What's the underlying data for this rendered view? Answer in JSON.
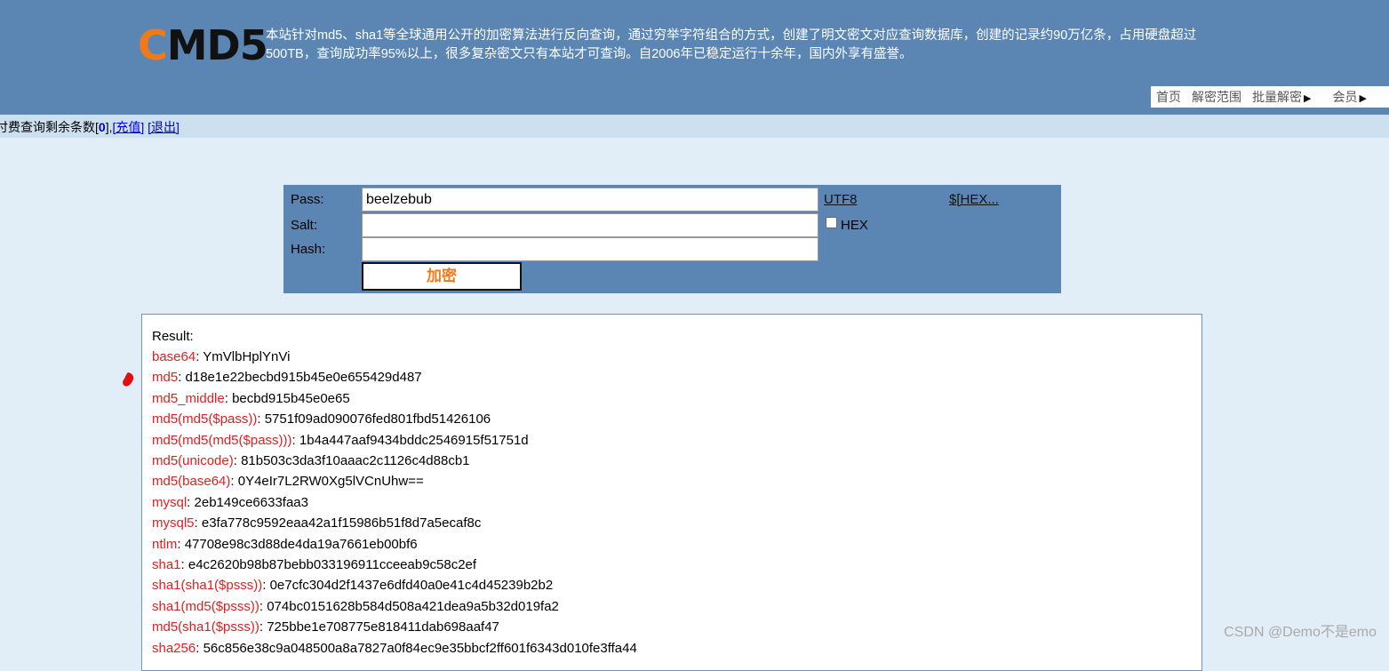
{
  "header": {
    "logo_c": "C",
    "logo_rest": "MD5",
    "intro": "本站针对md5、sha1等全球通用公开的加密算法进行反向查询，通过穷举字符组合的方式，创建了明文密文对应查询数据库，创建的记录约90万亿条，占用硬盘超过500TB，查询成功率95%以上，很多复杂密文只有本站才可查询。自2006年已稳定运行十余年，国内外享有盛誉。",
    "nav": [
      {
        "label": "首页"
      },
      {
        "label": "解密范围"
      },
      {
        "label": "批量解密"
      },
      {
        "label": "会员"
      }
    ]
  },
  "status": {
    "prefix": "付费查询剩余条数[",
    "count": "0",
    "suffix": "],",
    "recharge": "[充值]",
    "logout": "[退出]"
  },
  "form": {
    "pass_label": "Pass:",
    "pass_value": "beelzebub",
    "salt_label": "Salt:",
    "hash_label": "Hash:",
    "encode_link": "UTF8",
    "hex_link": "$[HEX...",
    "hex_checkbox_label": "HEX",
    "submit_label": "加密"
  },
  "result": {
    "title": "Result:",
    "rows": [
      {
        "k": "base64",
        "v": "YmVlbHplYnVi"
      },
      {
        "k": "md5",
        "v": "d18e1e22becbd915b45e0e655429d487"
      },
      {
        "k": "md5_middle",
        "v": "becbd915b45e0e65"
      },
      {
        "k": "md5(md5($pass))",
        "v": "5751f09ad090076fed801fbd51426106"
      },
      {
        "k": "md5(md5(md5($pass)))",
        "v": "1b4a447aaf9434bddc2546915f51751d"
      },
      {
        "k": "md5(unicode)",
        "v": "81b503c3da3f10aaac2c1126c4d88cb1"
      },
      {
        "k": "md5(base64)",
        "v": "0Y4eIr7L2RW0Xg5lVCnUhw=="
      },
      {
        "k": "mysql",
        "v": "2eb149ce6633faa3"
      },
      {
        "k": "mysql5",
        "v": "e3fa778c9592eaa42a1f15986b51f8d7a5ecaf8c"
      },
      {
        "k": "ntlm",
        "v": "47708e98c3d88de4da19a7661eb00bf6"
      },
      {
        "k": "sha1",
        "v": "e4c2620b98b87bebb033196911cceeab9c58c2ef"
      },
      {
        "k": "sha1(sha1($psss))",
        "v": "0e7cfc304d2f1437e6dfd40a0e41c4d45239b2b2"
      },
      {
        "k": "sha1(md5($psss))",
        "v": "074bc0151628b584d508a421dea9a5b32d019fa2"
      },
      {
        "k": "md5(sha1($psss))",
        "v": "725bbe1e708775e818411dab698aaf47"
      },
      {
        "k": "sha256",
        "v": "56c856e38c9a048500a8a7827a0f84ec9e35bbcf2ff601f6343d010fe3ffa44"
      }
    ]
  },
  "watermark": "CSDN @Demo不是emo",
  "colors": {
    "header_bg": "#5b86b3",
    "key_red": "#e02020",
    "logo_orange": "#f07a1a"
  }
}
